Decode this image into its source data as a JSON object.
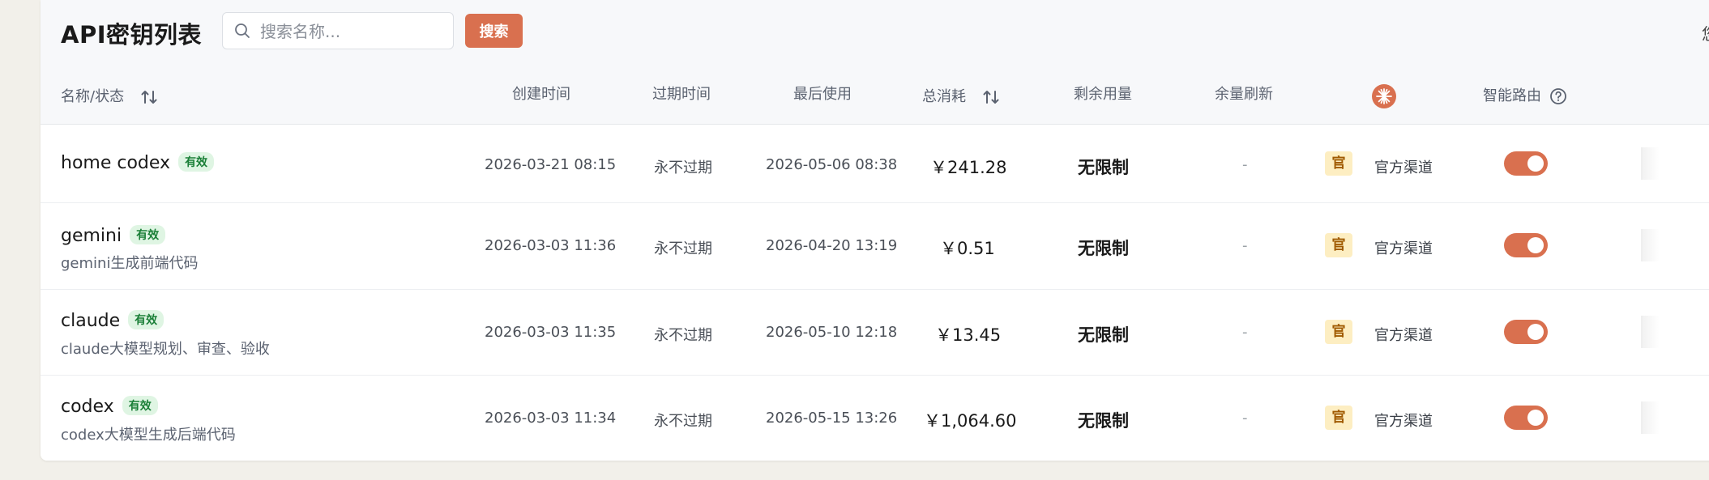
{
  "header": {
    "title": "API密钥列表",
    "search_placeholder": "搜索名称...",
    "search_button": "搜索",
    "right_text": "您i"
  },
  "columns": {
    "name_status": "名称/状态",
    "created": "创建时间",
    "expires": "过期时间",
    "last_used": "最后使用",
    "total_cost": "总消耗",
    "remaining": "剩余用量",
    "refresh": "余量刷新",
    "smart_route": "智能路由"
  },
  "colors": {
    "accent": "#d9704f",
    "badge_bg": "#dff5e3",
    "badge_text": "#1a7f37",
    "guan_bg": "#fdeec2"
  },
  "rows": [
    {
      "name": "home codex",
      "status": "有效",
      "desc": "",
      "created": "2026-03-21 08:15",
      "expires": "永不过期",
      "last_used": "2026-05-06 08:38",
      "cost": "￥241.28",
      "remaining": "无限制",
      "refresh": "-",
      "channel_badge": "官",
      "channel": "官方渠道",
      "smart_route_on": true
    },
    {
      "name": "gemini",
      "status": "有效",
      "desc": "gemini生成前端代码",
      "created": "2026-03-03 11:36",
      "expires": "永不过期",
      "last_used": "2026-04-20 13:19",
      "cost": "￥0.51",
      "remaining": "无限制",
      "refresh": "-",
      "channel_badge": "官",
      "channel": "官方渠道",
      "smart_route_on": true
    },
    {
      "name": "claude",
      "status": "有效",
      "desc": "claude大模型规划、审查、验收",
      "created": "2026-03-03 11:35",
      "expires": "永不过期",
      "last_used": "2026-05-10 12:18",
      "cost": "￥13.45",
      "remaining": "无限制",
      "refresh": "-",
      "channel_badge": "官",
      "channel": "官方渠道",
      "smart_route_on": true
    },
    {
      "name": "codex",
      "status": "有效",
      "desc": "codex大模型生成后端代码",
      "created": "2026-03-03 11:34",
      "expires": "永不过期",
      "last_used": "2026-05-15 13:26",
      "cost": "￥1,064.60",
      "remaining": "无限制",
      "refresh": "-",
      "channel_badge": "官",
      "channel": "官方渠道",
      "smart_route_on": true
    }
  ]
}
